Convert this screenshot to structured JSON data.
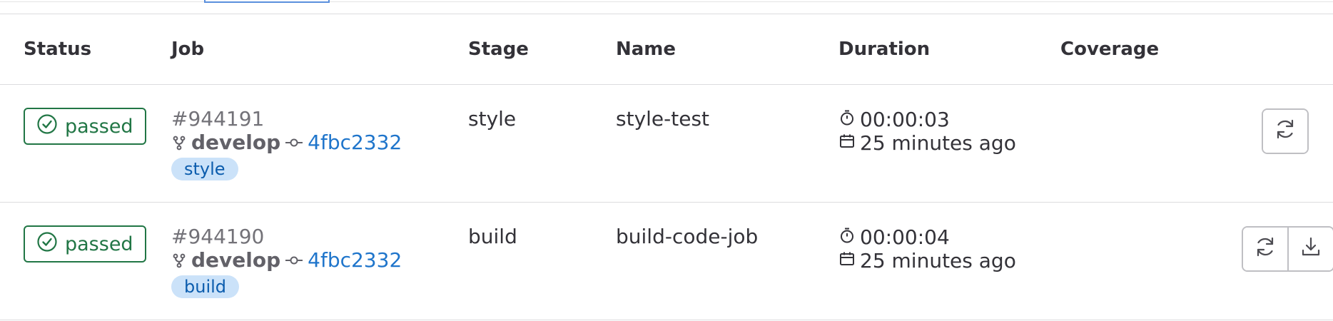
{
  "columns": {
    "status": "Status",
    "job": "Job",
    "stage": "Stage",
    "name": "Name",
    "duration": "Duration",
    "coverage": "Coverage"
  },
  "jobs": [
    {
      "status": "passed",
      "id": "#944191",
      "branch": "develop",
      "commit": "4fbc2332",
      "tag": "style",
      "stage": "style",
      "name": "style-test",
      "duration": "00:00:03",
      "finished": "25 minutes ago",
      "actions": [
        "retry-icon"
      ]
    },
    {
      "status": "passed",
      "id": "#944190",
      "branch": "develop",
      "commit": "4fbc2332",
      "tag": "build",
      "stage": "build",
      "name": "build-code-job",
      "duration": "00:00:04",
      "finished": "25 minutes ago",
      "actions": [
        "retry-icon",
        "download-icon"
      ]
    }
  ],
  "colors": {
    "success": "#217645",
    "link": "#1f75cb",
    "tag_bg": "#cbe2f9",
    "tag_text": "#0b5cad"
  }
}
